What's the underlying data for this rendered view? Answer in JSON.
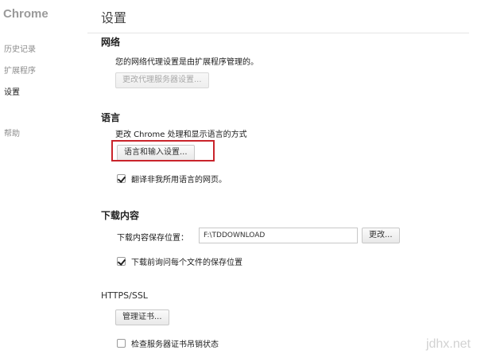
{
  "app": {
    "title": "Chrome"
  },
  "sidebar": {
    "items": [
      {
        "label": "历史记录"
      },
      {
        "label": "扩展程序"
      },
      {
        "label": "设置"
      },
      {
        "label": "帮助"
      }
    ]
  },
  "header": {
    "title": "设置"
  },
  "network": {
    "title": "网络",
    "description": "您的网络代理设置是由扩展程序管理的。",
    "button_label": "更改代理服务器设置..."
  },
  "language": {
    "title": "语言",
    "description": "更改 Chrome 处理和显示语言的方式",
    "button_label": "语言和输入设置...",
    "translate_checkbox": {
      "label": "翻译非我所用语言的网页。",
      "checked": true
    }
  },
  "downloads": {
    "title": "下载内容",
    "location_label": "下载内容保存位置：",
    "location_value": "F:\\TDDOWNLOAD",
    "change_button_label": "更改...",
    "ask_checkbox": {
      "label": "下载前询问每个文件的保存位置",
      "checked": true
    }
  },
  "https": {
    "title": "HTTPS/SSL",
    "manage_button_label": "管理证书...",
    "revocation_checkbox": {
      "label": "检查服务器证书吊销状态",
      "checked": false
    }
  },
  "watermark": "jdhx.net",
  "colors": {
    "highlight": "#c9242b",
    "background": "#ffffff"
  }
}
